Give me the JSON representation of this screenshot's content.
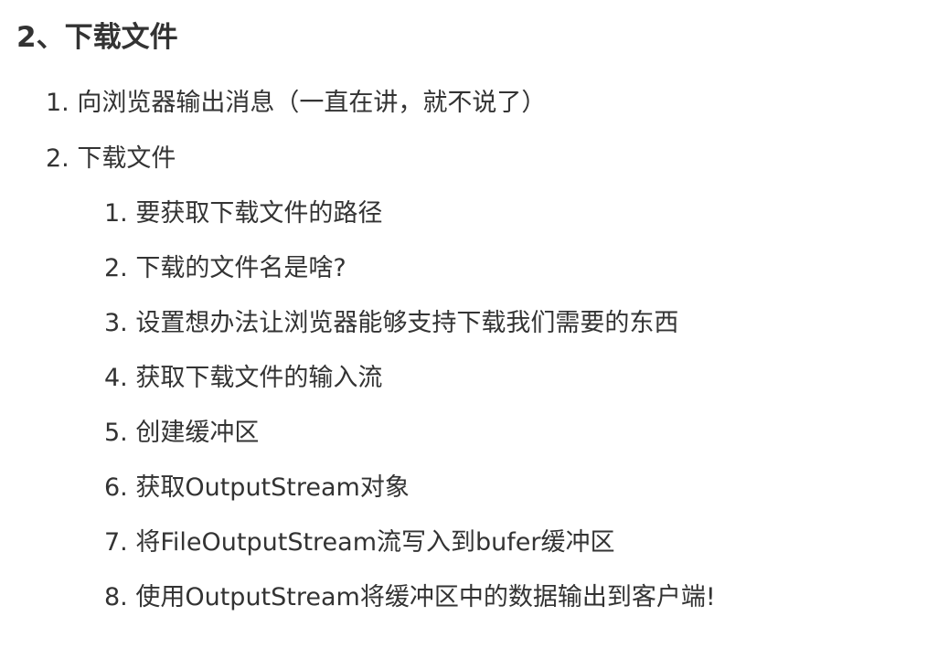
{
  "document": {
    "section_title": "2、下载文件",
    "items": [
      {
        "number": "1.",
        "text": "向浏览器输出消息（一直在讲，就不说了）"
      },
      {
        "number": "2.",
        "text": "下载文件",
        "subitems": [
          {
            "number": "1.",
            "text": "要获取下载文件的路径"
          },
          {
            "number": "2.",
            "text": "下载的文件名是啥?"
          },
          {
            "number": "3.",
            "text": "设置想办法让浏览器能够支持下载我们需要的东西"
          },
          {
            "number": "4.",
            "text": "获取下载文件的输入流"
          },
          {
            "number": "5.",
            "text": "创建缓冲区"
          },
          {
            "number": "6.",
            "text": "获取OutputStream对象"
          },
          {
            "number": "7.",
            "text": "将FileOutputStream流写入到bufer缓冲区"
          },
          {
            "number": "8.",
            "text": "使用OutputStream将缓冲区中的数据输出到客户端!"
          }
        ]
      }
    ]
  }
}
